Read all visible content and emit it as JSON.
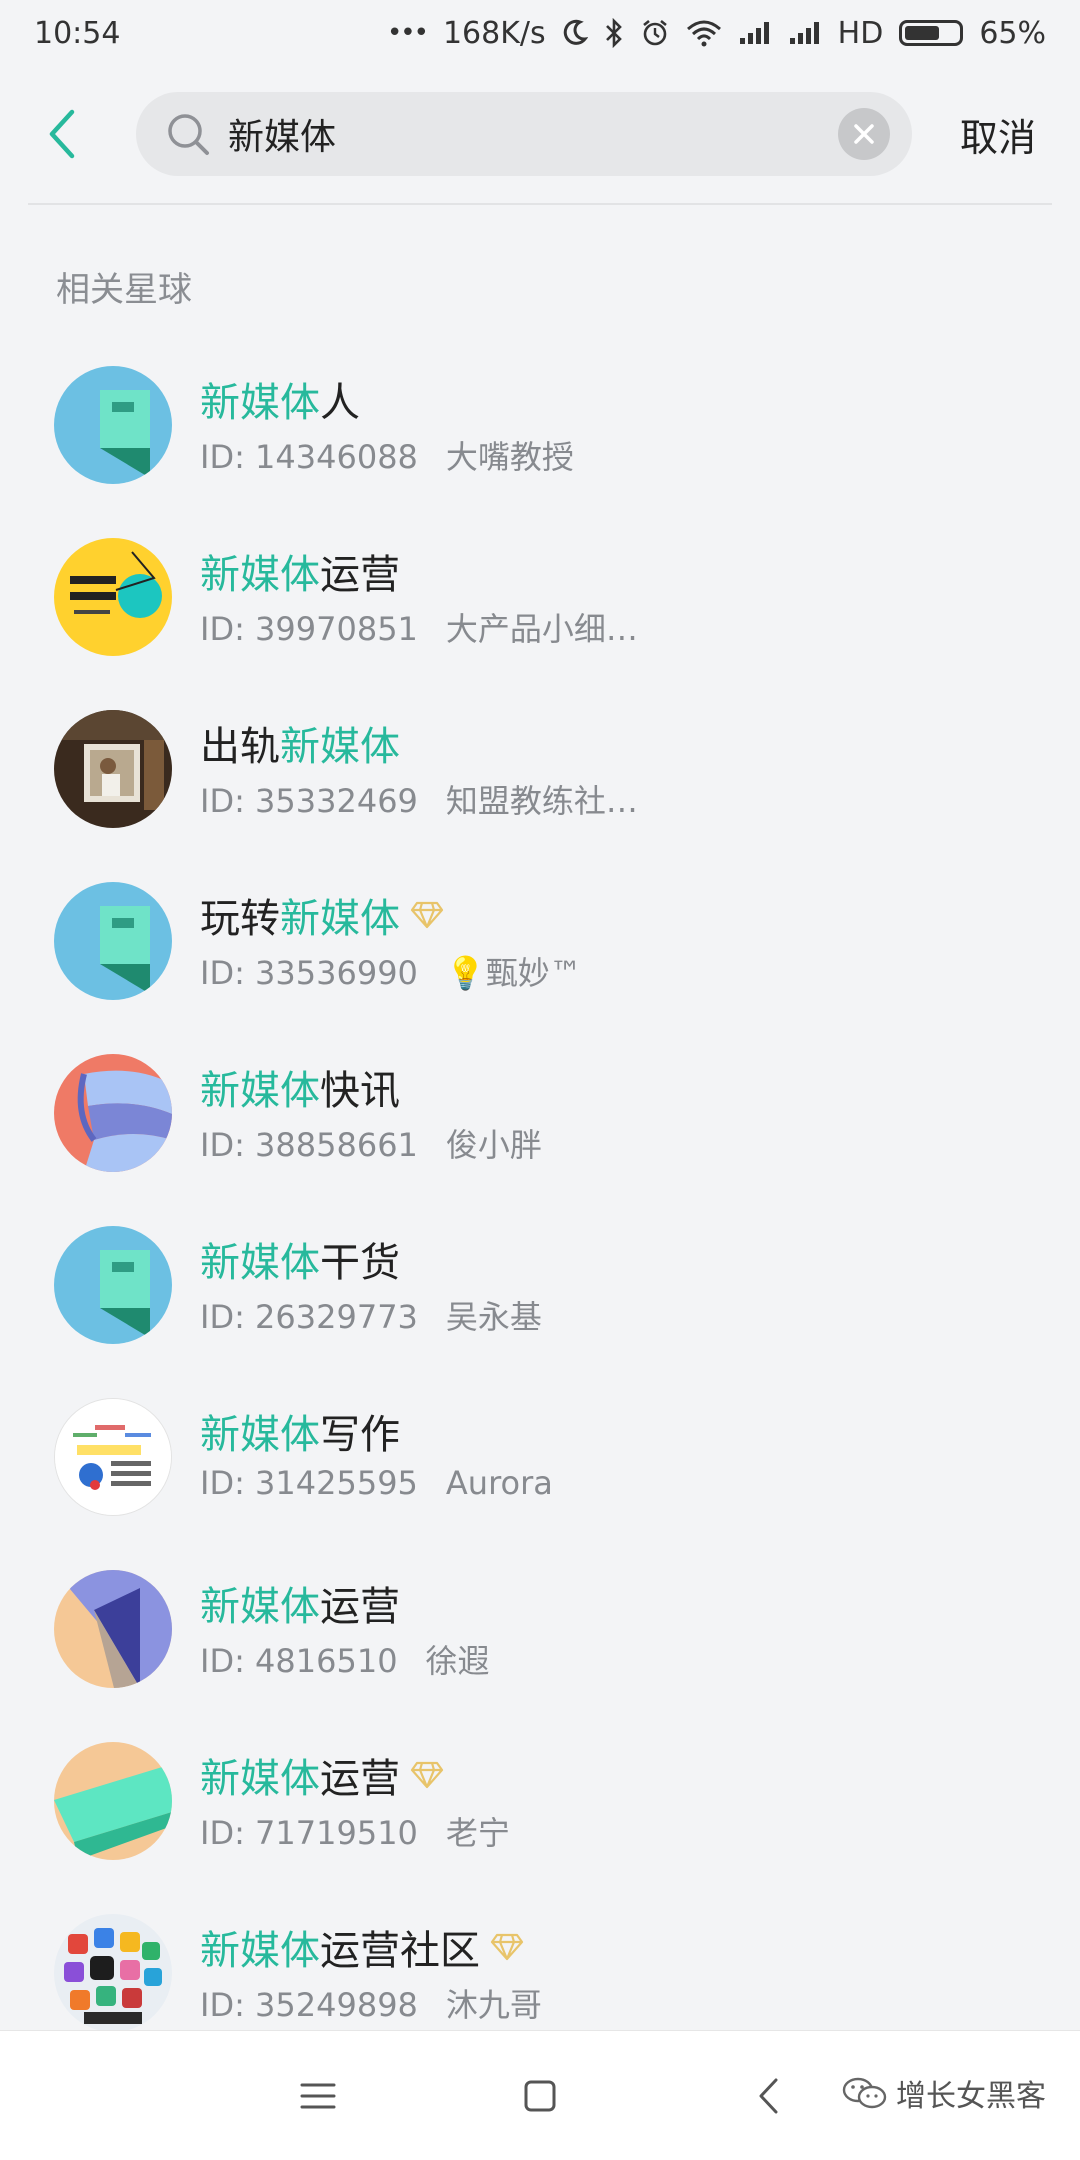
{
  "status_bar": {
    "time": "10:54",
    "dots": "•••",
    "speed": "168K/s",
    "network_label": "HD",
    "battery": "65%",
    "battery_level": 0.65
  },
  "header": {
    "search_value": "新媒体",
    "cancel_label": "取消"
  },
  "section_title": "相关星球",
  "results": [
    {
      "pre": "",
      "hl": "新媒体",
      "post": "人",
      "id": "ID: 14346088",
      "owner": "大嘴教授",
      "diamond": false,
      "avatar": "teal-bookmark-avatar"
    },
    {
      "pre": "",
      "hl": "新媒体",
      "post": "运营",
      "id": "ID: 39970851",
      "owner": "大产品小细…",
      "diamond": false,
      "avatar": "yellow-study-circle-avatar"
    },
    {
      "pre": "出轨",
      "hl": "新媒体",
      "post": "",
      "id": "ID: 35332469",
      "owner": "知盟教练社…",
      "diamond": false,
      "avatar": "photo-avatar"
    },
    {
      "pre": "玩转",
      "hl": "新媒体",
      "post": "",
      "id": "ID: 33536990",
      "owner": "💡甄妙™",
      "diamond": true,
      "avatar": "teal-bookmark-avatar"
    },
    {
      "pre": "",
      "hl": "新媒体",
      "post": "快讯",
      "id": "ID: 38858661",
      "owner": "俊小胖",
      "diamond": false,
      "avatar": "ribbon-avatar"
    },
    {
      "pre": "",
      "hl": "新媒体",
      "post": "干货",
      "id": "ID: 26329773",
      "owner": "吴永基",
      "diamond": false,
      "avatar": "teal-bookmark-avatar"
    },
    {
      "pre": "",
      "hl": "新媒体",
      "post": "写作",
      "id": "ID: 31425595",
      "owner": "Aurora",
      "diamond": false,
      "avatar": "writing-course-avatar"
    },
    {
      "pre": "",
      "hl": "新媒体",
      "post": "运营",
      "id": "ID: 4816510",
      "owner": "徐遐",
      "diamond": false,
      "avatar": "purple-triangle-avatar"
    },
    {
      "pre": "",
      "hl": "新媒体",
      "post": "运营",
      "id": "ID: 71719510",
      "owner": "老宁",
      "diamond": true,
      "avatar": "green-stripe-avatar"
    },
    {
      "pre": "",
      "hl": "新媒体",
      "post": "运营社区",
      "id": "ID: 35249898",
      "owner": "沐九哥",
      "diamond": true,
      "avatar": "app-icons-avatar"
    }
  ],
  "watermark": "增长女黑客",
  "colors": {
    "highlight": "#27b99c",
    "background": "#f3f4f6",
    "meta_text": "#878a8f",
    "diamond": "#e8c46a"
  }
}
